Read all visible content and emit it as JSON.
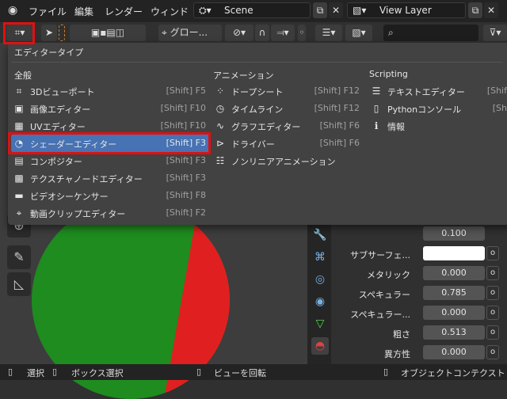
{
  "topbar": {
    "menus": [
      "ファイル",
      "編集",
      "レンダー",
      "ウィンド"
    ],
    "scene": "Scene",
    "view_layer": "View Layer"
  },
  "toolbar": {
    "orientation": "グロー...",
    "search_placeholder": ""
  },
  "popup": {
    "title": "エディタータイプ",
    "columns": [
      {
        "head": "全般",
        "items": [
          {
            "icon": "3d-viewport-icon",
            "glyph": "⌗",
            "label": "3Dビューポート",
            "shortcut": "[Shift] F5"
          },
          {
            "icon": "image-editor-icon",
            "glyph": "▣",
            "label": "画像エディター",
            "shortcut": "[Shift] F10"
          },
          {
            "icon": "uv-editor-icon",
            "glyph": "▦",
            "label": "UVエディター",
            "shortcut": "[Shift] F10"
          },
          {
            "icon": "shader-editor-icon",
            "glyph": "◔",
            "label": "シェーダーエディター",
            "shortcut": "[Shift] F3"
          },
          {
            "icon": "compositor-icon",
            "glyph": "▤",
            "label": "コンポジター",
            "shortcut": "[Shift] F3"
          },
          {
            "icon": "texture-node-icon",
            "glyph": "▩",
            "label": "テクスチャノードエディター",
            "shortcut": "[Shift] F3"
          },
          {
            "icon": "video-sequencer-icon",
            "glyph": "▬",
            "label": "ビデオシーケンサー",
            "shortcut": "[Shift] F8"
          },
          {
            "icon": "movie-clip-icon",
            "glyph": "⌖",
            "label": "動画クリップエディター",
            "shortcut": "[Shift] F2"
          }
        ]
      },
      {
        "head": "アニメーション",
        "items": [
          {
            "icon": "dope-sheet-icon",
            "glyph": "⁘",
            "label": "ドープシート",
            "shortcut": "[Shift] F12"
          },
          {
            "icon": "timeline-icon",
            "glyph": "◷",
            "label": "タイムライン",
            "shortcut": "[Shift] F12"
          },
          {
            "icon": "graph-editor-icon",
            "glyph": "∿",
            "label": "グラフエディター",
            "shortcut": "[Shift] F6"
          },
          {
            "icon": "drivers-icon",
            "glyph": "⊳",
            "label": "ドライバー",
            "shortcut": "[Shift] F6"
          },
          {
            "icon": "nla-icon",
            "glyph": "☷",
            "label": "ノンリニアアニメーション",
            "shortcut": ""
          }
        ]
      },
      {
        "head": "Scripting",
        "items": [
          {
            "icon": "text-editor-icon",
            "glyph": "☰",
            "label": "テキストエディター",
            "shortcut": "[Shif"
          },
          {
            "icon": "python-console-icon",
            "glyph": "▯",
            "label": "Pythonコンソール",
            "shortcut": "[Sh"
          },
          {
            "icon": "info-icon",
            "glyph": "ℹ",
            "label": "情報",
            "shortcut": ""
          }
        ]
      }
    ]
  },
  "properties": {
    "rows": [
      {
        "label": "",
        "value": "0.100"
      },
      {
        "label": "サブサーフェ...",
        "value": ""
      },
      {
        "label": "メタリック",
        "value": "0.000"
      },
      {
        "label": "スペキュラー",
        "value": "0.785"
      },
      {
        "label": "スペキュラー...",
        "value": "0.000"
      },
      {
        "label": "粗さ",
        "value": "0.513"
      },
      {
        "label": "異方性",
        "value": "0.000"
      }
    ]
  },
  "statusbar": {
    "select": "選択",
    "box_select": "ボックス選択",
    "rotate_view": "ビューを回転",
    "context": "オブジェクトコンテクスト"
  },
  "colors": {
    "highlight": "#4772b3",
    "annotation": "#e01010"
  }
}
